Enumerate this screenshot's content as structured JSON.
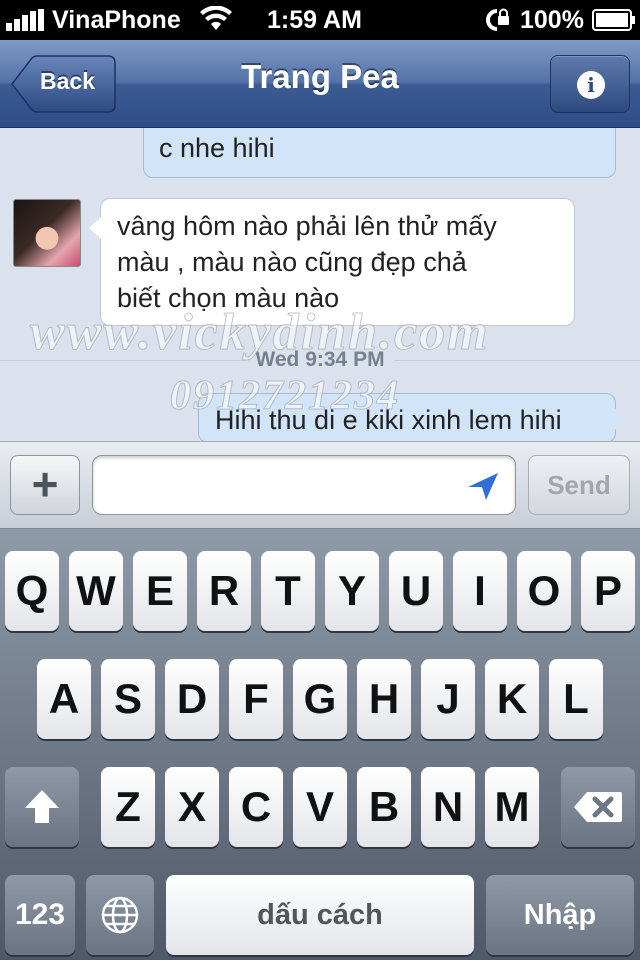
{
  "status_bar": {
    "carrier": "VinaPhone",
    "time": "1:59 AM",
    "battery": "100%"
  },
  "nav": {
    "back_label": "Back",
    "title": "Trang Pea",
    "info_icon": "info-icon"
  },
  "messages": [
    {
      "direction": "outgoing",
      "text": "c nhe hihi"
    },
    {
      "direction": "incoming",
      "lines": [
        "vâng hôm nào phải lên thử mấy",
        "màu , màu nào cũng đẹp chả",
        "biết chọn màu nào"
      ]
    },
    {
      "direction": "outgoing",
      "text": "Hihi thu di e kiki xinh lem hihi"
    }
  ],
  "timestamp": "Wed 9:34 PM",
  "watermark": {
    "site": "www.vickydinh.com",
    "phone": "0912721234"
  },
  "composer": {
    "plus_label": "+",
    "input_value": "",
    "send_label": "Send"
  },
  "keyboard": {
    "row1": [
      "Q",
      "W",
      "E",
      "R",
      "T",
      "Y",
      "U",
      "I",
      "O",
      "P"
    ],
    "row2": [
      "A",
      "S",
      "D",
      "F",
      "G",
      "H",
      "J",
      "K",
      "L"
    ],
    "row3": [
      "Z",
      "X",
      "C",
      "V",
      "B",
      "N",
      "M"
    ],
    "numbers_label": "123",
    "space_label": "dấu cách",
    "return_label": "Nhập"
  }
}
